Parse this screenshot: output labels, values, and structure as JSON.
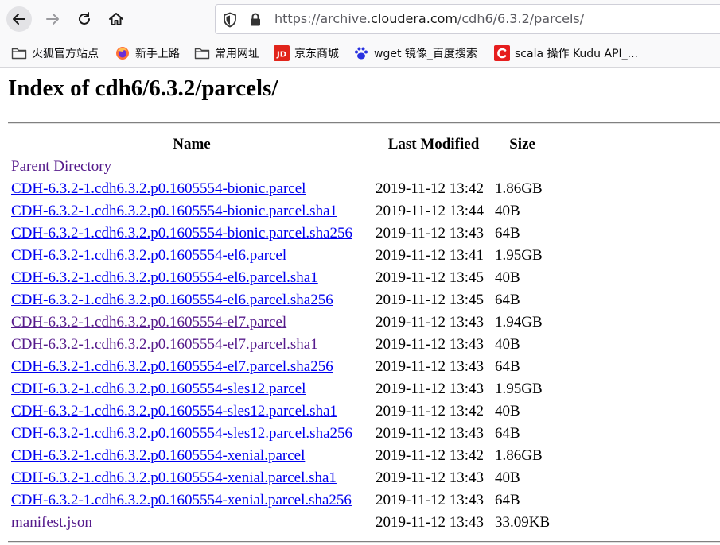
{
  "browser": {
    "url_prefix": "https://archive.",
    "url_host": "cloudera.com",
    "url_path": "/cdh6/6.3.2/parcels/",
    "bookmarks": [
      {
        "label": "火狐官方站点",
        "icon": "folder-icon"
      },
      {
        "label": "新手上路",
        "icon": "firefox-icon"
      },
      {
        "label": "常用网址",
        "icon": "folder-icon"
      },
      {
        "label": "京东商城",
        "icon": "jd-icon"
      },
      {
        "label": "wget 镜像_百度搜索",
        "icon": "baidu-paw-icon"
      },
      {
        "label": "scala 操作 Kudu API_...",
        "icon": "csdn-icon"
      }
    ]
  },
  "page": {
    "title": "Index of cdh6/6.3.2/parcels/",
    "columns": {
      "name": "Name",
      "last_modified": "Last Modified",
      "size": "Size"
    },
    "parent_label": "Parent Directory",
    "rows": [
      {
        "name": "CDH-6.3.2-1.cdh6.3.2.p0.1605554-bionic.parcel",
        "modified": "2019-11-12 13:42",
        "size": "1.86GB",
        "visited": false
      },
      {
        "name": "CDH-6.3.2-1.cdh6.3.2.p0.1605554-bionic.parcel.sha1",
        "modified": "2019-11-12 13:44",
        "size": "40B",
        "visited": false
      },
      {
        "name": "CDH-6.3.2-1.cdh6.3.2.p0.1605554-bionic.parcel.sha256",
        "modified": "2019-11-12 13:43",
        "size": "64B",
        "visited": false
      },
      {
        "name": "CDH-6.3.2-1.cdh6.3.2.p0.1605554-el6.parcel",
        "modified": "2019-11-12 13:41",
        "size": "1.95GB",
        "visited": false
      },
      {
        "name": "CDH-6.3.2-1.cdh6.3.2.p0.1605554-el6.parcel.sha1",
        "modified": "2019-11-12 13:45",
        "size": "40B",
        "visited": false
      },
      {
        "name": "CDH-6.3.2-1.cdh6.3.2.p0.1605554-el6.parcel.sha256",
        "modified": "2019-11-12 13:45",
        "size": "64B",
        "visited": false
      },
      {
        "name": "CDH-6.3.2-1.cdh6.3.2.p0.1605554-el7.parcel",
        "modified": "2019-11-12 13:43",
        "size": "1.94GB",
        "visited": true
      },
      {
        "name": "CDH-6.3.2-1.cdh6.3.2.p0.1605554-el7.parcel.sha1",
        "modified": "2019-11-12 13:43",
        "size": "40B",
        "visited": true
      },
      {
        "name": "CDH-6.3.2-1.cdh6.3.2.p0.1605554-el7.parcel.sha256",
        "modified": "2019-11-12 13:43",
        "size": "64B",
        "visited": false
      },
      {
        "name": "CDH-6.3.2-1.cdh6.3.2.p0.1605554-sles12.parcel",
        "modified": "2019-11-12 13:43",
        "size": "1.95GB",
        "visited": false
      },
      {
        "name": "CDH-6.3.2-1.cdh6.3.2.p0.1605554-sles12.parcel.sha1",
        "modified": "2019-11-12 13:42",
        "size": "40B",
        "visited": false
      },
      {
        "name": "CDH-6.3.2-1.cdh6.3.2.p0.1605554-sles12.parcel.sha256",
        "modified": "2019-11-12 13:43",
        "size": "64B",
        "visited": false
      },
      {
        "name": "CDH-6.3.2-1.cdh6.3.2.p0.1605554-xenial.parcel",
        "modified": "2019-11-12 13:42",
        "size": "1.86GB",
        "visited": false
      },
      {
        "name": "CDH-6.3.2-1.cdh6.3.2.p0.1605554-xenial.parcel.sha1",
        "modified": "2019-11-12 13:43",
        "size": "40B",
        "visited": false
      },
      {
        "name": "CDH-6.3.2-1.cdh6.3.2.p0.1605554-xenial.parcel.sha256",
        "modified": "2019-11-12 13:43",
        "size": "64B",
        "visited": false
      },
      {
        "name": "manifest.json",
        "modified": "2019-11-12 13:43",
        "size": "33.09KB",
        "visited": true
      }
    ]
  },
  "colors": {
    "link": "#0000ee",
    "visited_link": "#551a8b",
    "chrome_bg": "#f9f9fa"
  }
}
